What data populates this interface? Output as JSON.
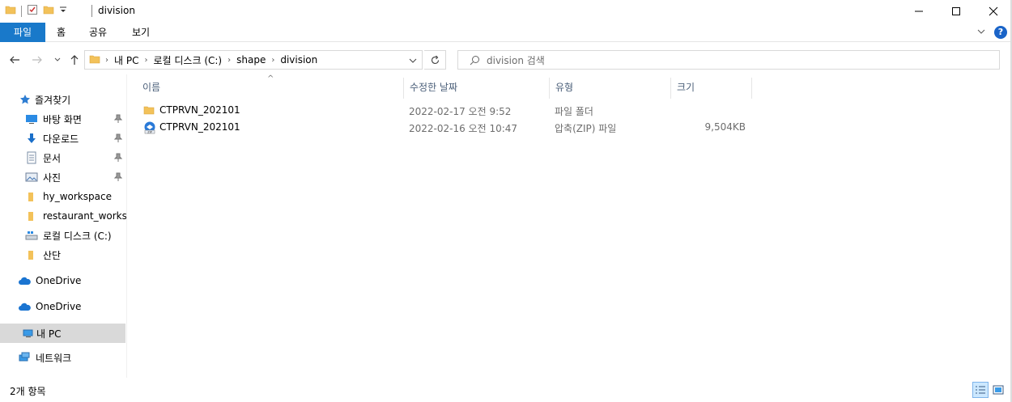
{
  "window": {
    "title": "division"
  },
  "ribbon": {
    "tabs": [
      "파일",
      "홈",
      "공유",
      "보기"
    ],
    "help_label": "?"
  },
  "address": {
    "crumbs": [
      "내 PC",
      "로컬 디스크 (C:)",
      "shape",
      "division"
    ]
  },
  "search": {
    "placeholder": "division 검색"
  },
  "sidebar": {
    "items": [
      {
        "label": "즐겨찾기",
        "icon": "star-icon"
      },
      {
        "label": "바탕 화면",
        "icon": "desktop-icon",
        "pinned": true
      },
      {
        "label": "다운로드",
        "icon": "download-icon",
        "pinned": true
      },
      {
        "label": "문서",
        "icon": "document-icon",
        "pinned": true
      },
      {
        "label": "사진",
        "icon": "picture-icon",
        "pinned": true
      },
      {
        "label": "hy_workspace",
        "icon": "folder-icon"
      },
      {
        "label": "restaurant_workspace",
        "icon": "folder-icon"
      },
      {
        "label": "로컬 디스크 (C:)",
        "icon": "drive-icon"
      },
      {
        "label": "산단",
        "icon": "folder-icon"
      },
      {
        "label": "OneDrive",
        "icon": "cloud-icon"
      },
      {
        "label": "OneDrive",
        "icon": "cloud-icon"
      },
      {
        "label": "내 PC",
        "icon": "pc-icon",
        "selected": true
      },
      {
        "label": "네트워크",
        "icon": "network-icon"
      }
    ]
  },
  "columns": {
    "name": "이름",
    "modified": "수정한 날짜",
    "type": "유형",
    "size": "크기"
  },
  "files": [
    {
      "name": "CTPRVN_202101",
      "modified": "2022-02-17 오전 9:52",
      "type": "파일 폴더",
      "size": "",
      "icon": "folder-icon"
    },
    {
      "name": "CTPRVN_202101",
      "modified": "2022-02-16 오전 10:47",
      "type": "압축(ZIP) 파일",
      "size": "9,504KB",
      "icon": "zip-icon"
    }
  ],
  "status": {
    "count_text": "2개 항목"
  },
  "colors": {
    "file_tab": "#1979ca",
    "header_text": "#4c607a",
    "selected_bg": "#d9d9d9",
    "folder": "#f3c25a",
    "onedrive": "#1a74d1"
  }
}
